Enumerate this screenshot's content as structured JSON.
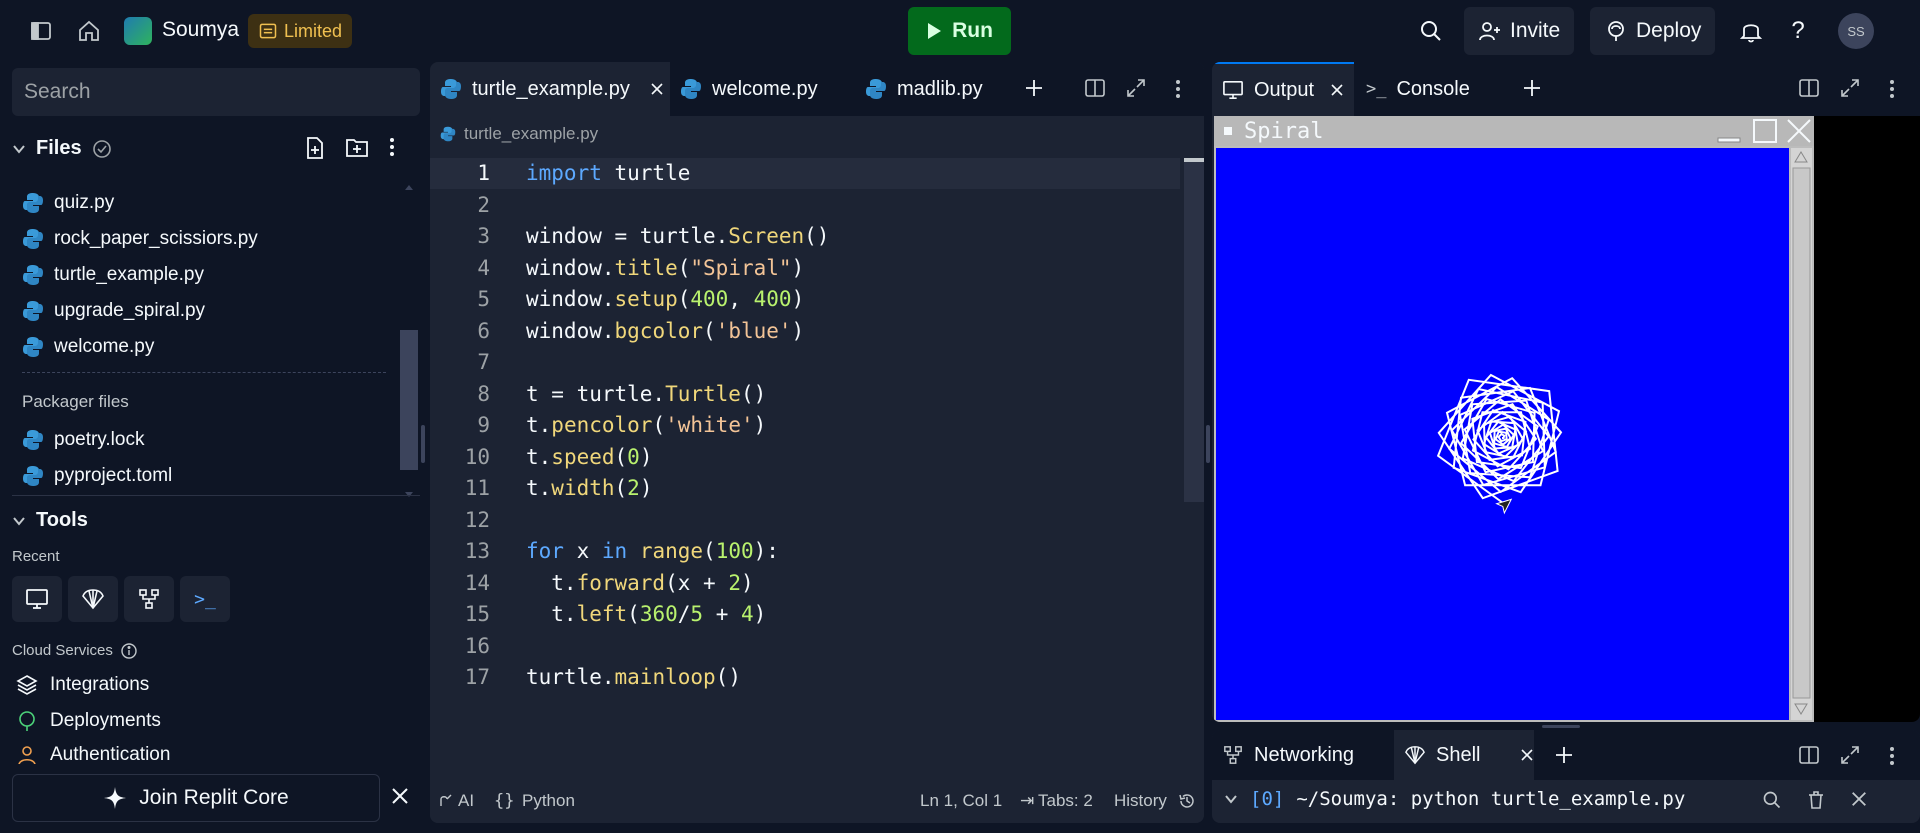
{
  "topbar": {
    "repl_name": "Soumya",
    "badge": "Limited",
    "run_label": "Run",
    "invite_label": "Invite",
    "deploy_label": "Deploy",
    "user_initials": "SS"
  },
  "sidebar": {
    "search_placeholder": "Search",
    "files_title": "Files",
    "files": [
      "quiz.py",
      "rock_paper_scissiors.py",
      "turtle_example.py",
      "upgrade_spiral.py",
      "welcome.py"
    ],
    "packager_title": "Packager files",
    "packager_files": [
      "poetry.lock",
      "pyproject.toml"
    ],
    "tools_title": "Tools",
    "recent_label": "Recent",
    "cloud_label": "Cloud Services",
    "cloud_items": [
      "Integrations",
      "Deployments",
      "Authentication"
    ],
    "join_core_label": "Join Replit Core"
  },
  "editor": {
    "tabs": [
      "turtle_example.py",
      "welcome.py",
      "madlib.py"
    ],
    "breadcrumb": "turtle_example.py",
    "line_numbers": [
      "1",
      "2",
      "3",
      "4",
      "5",
      "6",
      "7",
      "8",
      "9",
      "10",
      "11",
      "12",
      "13",
      "14",
      "15",
      "16",
      "17"
    ],
    "status": {
      "ai": "AI",
      "language": "Python",
      "position": "Ln 1, Col 1",
      "tabs": "Tabs: 2",
      "history": "History"
    }
  },
  "output": {
    "tabs": [
      "Output",
      "Console"
    ],
    "window_title": "Spiral"
  },
  "shell": {
    "tabs": [
      "Networking",
      "Shell"
    ],
    "prompt_index": "[0]",
    "command": "~/Soumya: python turtle_example.py"
  },
  "colors": {
    "bg": "#0e1525",
    "panel": "#1c2333",
    "run": "#036a1c",
    "turtle_bg": "#0000ff",
    "keyword": "#5da9ff",
    "function": "#f0d77b",
    "string": "#f3c497",
    "number": "#b9f26e"
  }
}
